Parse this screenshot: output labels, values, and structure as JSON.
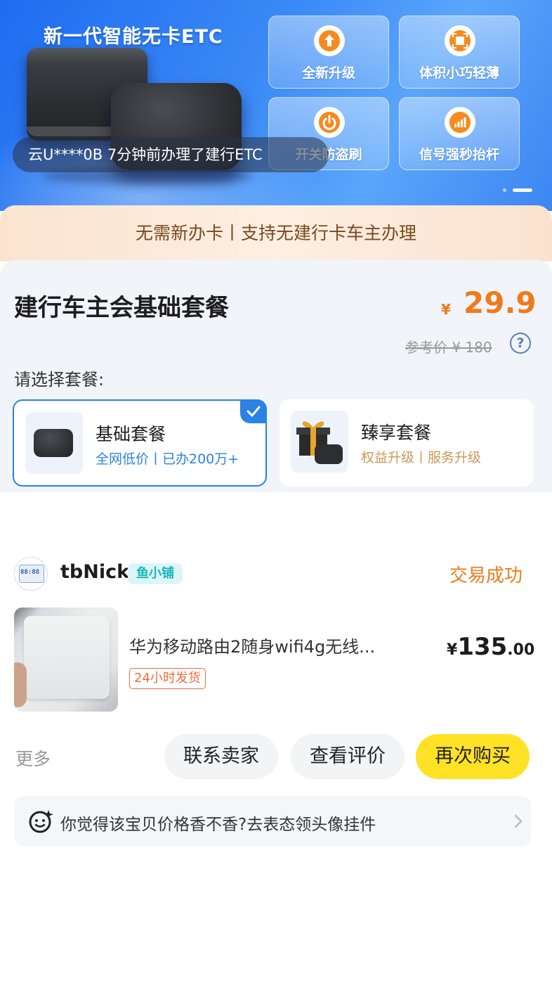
{
  "banner": {
    "title": "新一代智能无卡ETC",
    "features": [
      {
        "label": "全新升级",
        "icon": "arrow-up-icon"
      },
      {
        "label": "体积小巧轻薄",
        "icon": "square-frame-icon"
      },
      {
        "label": "开关防盗刷",
        "icon": "power-icon"
      },
      {
        "label": "信号强秒抬杆",
        "icon": "signal-bars-icon"
      }
    ],
    "toast": "云U****0B 7分钟前办理了建行ETC",
    "carousel": {
      "count": 2,
      "active": 2
    }
  },
  "tip": "无需新办卡丨支持无建行卡车主办理",
  "package": {
    "title": "建行车主会基础套餐",
    "price_symbol": "¥",
    "price": "29.9",
    "ref_price": "参考价 ¥ 180",
    "help": "?",
    "choose_label": "请选择套餐:",
    "options": [
      {
        "name": "基础套餐",
        "sub": "全网低价丨已办200万+",
        "selected": true
      },
      {
        "name": "臻享套餐",
        "sub": "权益升级丨服务升级",
        "selected": false
      }
    ]
  },
  "order": {
    "avatar_text": "88:88",
    "nick": "tbNick",
    "shop_badge": "鱼小铺",
    "status": "交易成功",
    "product_name": "华为移动路由2随身wifi4g无线...",
    "ship_tag": "24小时发货",
    "price_symbol": "¥",
    "price_int": "135",
    "price_dec": ".00",
    "more": "更多",
    "buttons": {
      "contact": "联系卖家",
      "review": "查看评价",
      "rebuy": "再次购买"
    },
    "survey": "你觉得该宝贝价格香不香?去表态领头像挂件"
  },
  "colors": {
    "accent_orange": "#f07a1b",
    "select_blue": "#2a82e4",
    "rebuy_yellow": "#ffe226",
    "teal_badge": "#1ab5bd"
  }
}
